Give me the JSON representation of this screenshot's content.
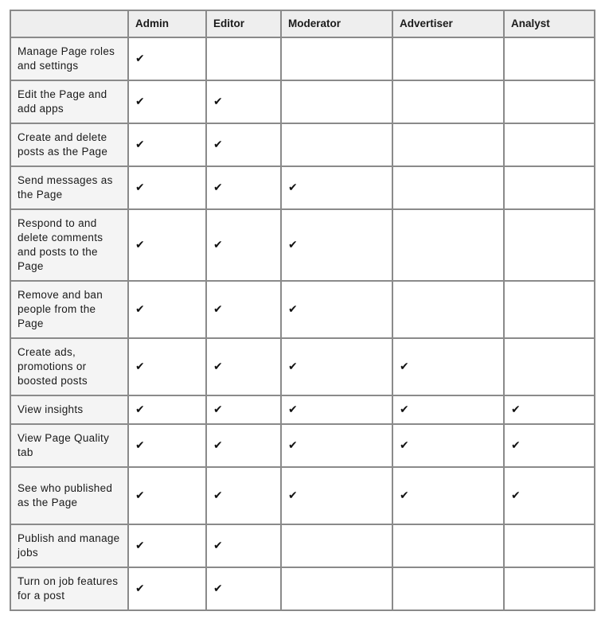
{
  "table": {
    "headers": [
      "",
      "Admin",
      "Editor",
      "Moderator",
      "Advertiser",
      "Analyst"
    ],
    "check_glyph": "✔",
    "rows": [
      {
        "permission": "Manage Page roles and settings",
        "roles": [
          true,
          false,
          false,
          false,
          false
        ]
      },
      {
        "permission": "Edit the Page and add apps",
        "roles": [
          true,
          true,
          false,
          false,
          false
        ]
      },
      {
        "permission": "Create and delete posts as the Page",
        "roles": [
          true,
          true,
          false,
          false,
          false
        ]
      },
      {
        "permission": "Send messages as the Page",
        "roles": [
          true,
          true,
          true,
          false,
          false
        ]
      },
      {
        "permission": "Respond to and delete comments and posts to the Page",
        "roles": [
          true,
          true,
          true,
          false,
          false
        ]
      },
      {
        "permission": "Remove and ban people from the Page",
        "roles": [
          true,
          true,
          true,
          false,
          false
        ]
      },
      {
        "permission": "Create ads, promotions or boosted posts",
        "roles": [
          true,
          true,
          true,
          true,
          false
        ]
      },
      {
        "permission": "View insights",
        "roles": [
          true,
          true,
          true,
          true,
          true
        ]
      },
      {
        "permission": "View Page Quality tab",
        "roles": [
          true,
          true,
          true,
          true,
          true
        ]
      },
      {
        "permission": "See who published as the Page",
        "roles": [
          true,
          true,
          true,
          true,
          true
        ]
      },
      {
        "permission": "Publish and manage jobs",
        "roles": [
          true,
          true,
          false,
          false,
          false
        ]
      },
      {
        "permission": "Turn on job features for a post",
        "roles": [
          true,
          true,
          false,
          false,
          false
        ]
      }
    ]
  }
}
